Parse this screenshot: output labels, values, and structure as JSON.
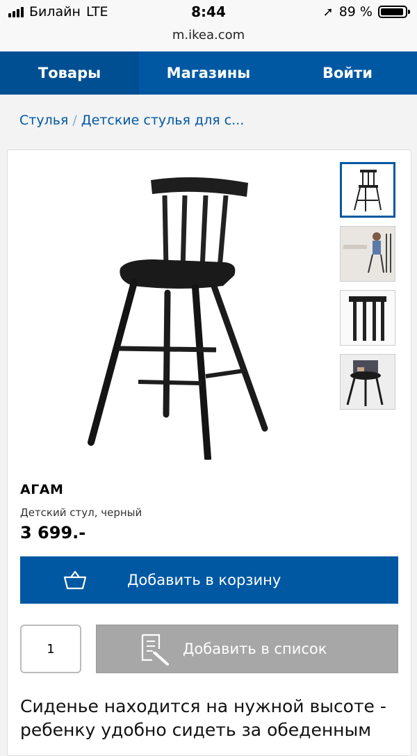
{
  "status_bar": {
    "carrier": "Билайн",
    "network": "LTE",
    "time": "8:44",
    "battery": "89 %",
    "url": "m.ikea.com"
  },
  "nav": {
    "items": [
      {
        "label": "Товары"
      },
      {
        "label": "Магазины"
      },
      {
        "label": "Войти"
      }
    ]
  },
  "breadcrumb": {
    "items": [
      "Стулья",
      "Детские стулья для с..."
    ],
    "separator": "/"
  },
  "product": {
    "name": "АГАМ",
    "description": "Детский стул, черный",
    "price": "3 699.-",
    "add_to_cart_label": "Добавить в корзину",
    "quantity": "1",
    "add_to_list_label": "Добавить в список",
    "long_description": "Сиденье находится на нужной высоте - ребенку удобно сидеть за обеденным"
  },
  "colors": {
    "brand_blue": "#0058a3",
    "disabled_gray": "#a7a7a7"
  },
  "icons": {
    "cart": "basket-icon",
    "list": "shopping-list-icon",
    "location": "location-arrow-icon"
  }
}
